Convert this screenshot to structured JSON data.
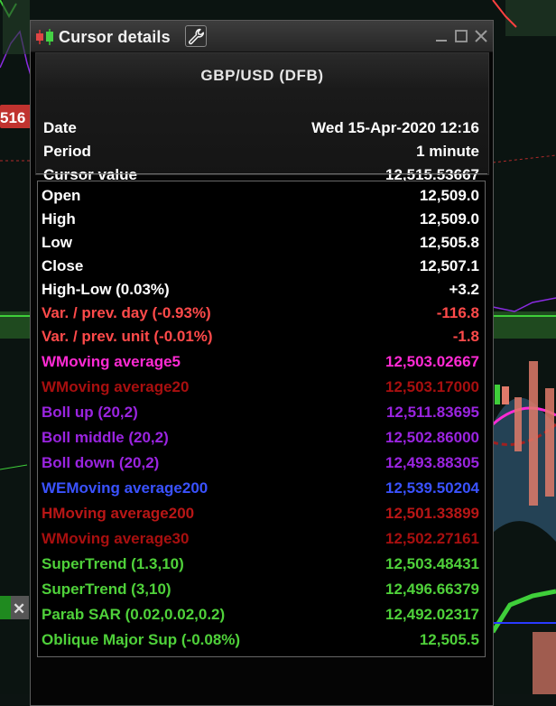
{
  "window": {
    "title": "Cursor details",
    "app_icon": "candlestick-icon",
    "settings_icon": "wrench-icon"
  },
  "header": {
    "instrument": "GBP/USD (DFB)",
    "fields": [
      {
        "label": "Date",
        "value": "Wed 15-Apr-2020 12:16"
      },
      {
        "label": "Period",
        "value": "1 minute"
      },
      {
        "label": "Cursor value",
        "value": "12,515.53667"
      }
    ]
  },
  "rows": [
    {
      "label": "Open",
      "value": "12,509.0",
      "color": "#ffffff"
    },
    {
      "label": "High",
      "value": "12,509.0",
      "color": "#ffffff"
    },
    {
      "label": "Low",
      "value": "12,505.8",
      "color": "#ffffff"
    },
    {
      "label": "Close",
      "value": "12,507.1",
      "color": "#ffffff"
    },
    {
      "label": "High-Low (0.03%)",
      "value": "+3.2",
      "color": "#ffffff"
    },
    {
      "label": "Var. / prev. day (-0.93%)",
      "value": "-116.8",
      "color": "#ff4a4a"
    },
    {
      "label": "Var. / prev. unit (-0.01%)",
      "value": "-1.8",
      "color": "#ff4a4a"
    },
    {
      "label": "WMoving average5",
      "value": "12,503.02667",
      "color": "#ff2ad4"
    },
    {
      "label": "WMoving average20",
      "value": "12,503.17000",
      "color": "#a80f0f"
    },
    {
      "label": "Boll up (20,2)",
      "value": "12,511.83695",
      "color": "#9a24e0"
    },
    {
      "label": "Boll middle (20,2)",
      "value": "12,502.86000",
      "color": "#9a24e0"
    },
    {
      "label": "Boll down (20,2)",
      "value": "12,493.88305",
      "color": "#9a24e0"
    },
    {
      "label": "WEMoving average200",
      "value": "12,539.50204",
      "color": "#3a52ff"
    },
    {
      "label": "HMoving average200",
      "value": "12,501.33899",
      "color": "#b81616"
    },
    {
      "label": "WMoving average30",
      "value": "12,502.27161",
      "color": "#a80f0f"
    },
    {
      "label": "SuperTrend (1.3,10)",
      "value": "12,503.48431",
      "color": "#4fd13a"
    },
    {
      "label": "SuperTrend (3,10)",
      "value": "12,496.66379",
      "color": "#4fd13a"
    },
    {
      "label": "Parab SAR (0.02,0.02,0.2)",
      "value": "12,492.02317",
      "color": "#4fd13a"
    },
    {
      "label": "Oblique Major Sup (-0.08%)",
      "value": "12,505.5",
      "color": "#4fd13a"
    }
  ],
  "background": {
    "price_tag": "516",
    "tag_color": "#c0332f",
    "accent_green": "#3fcf3a"
  }
}
